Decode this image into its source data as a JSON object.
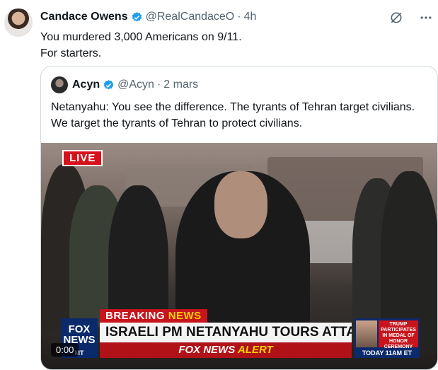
{
  "tweet": {
    "author_name": "Candace Owens",
    "handle": "@RealCandaceO",
    "separator": "·",
    "time": "4h",
    "text_line1": "You murdered 3,000 Americans on 9/11.",
    "text_line2": "For starters."
  },
  "icons": {
    "verified": "verified-badge-icon",
    "grok": "grok-icon",
    "more": "more-icon"
  },
  "colors": {
    "verified": "#1d9bf0",
    "muted": "#536471",
    "fox_red": "#c8141c",
    "fox_blue": "#0b2a6b"
  },
  "quote": {
    "author_name": "Acyn",
    "handle": "@Acyn",
    "separator": "·",
    "date": "2 mars",
    "text": "Netanyahu: You see the difference. The tyrants of Tehran target civilians. We target the tyrants of Tehran to protect civilians."
  },
  "video": {
    "live_label": "LIVE",
    "breaking_label": "BREAKING",
    "breaking_news": "NEWS",
    "headline": "ISRAELI PM NETANYAHU TOURS ATTACK SITE",
    "alert_brand": "FOX NEWS",
    "alert_word": "ALERT",
    "fox_logo": "FOX NEWS",
    "fox_sub": "MT",
    "promo_text": "TRUMP PARTICIPATES IN MEDAL OF HONOR CEREMONY",
    "promo_time": "TODAY 11AM ET",
    "timestamp": "0:00"
  }
}
